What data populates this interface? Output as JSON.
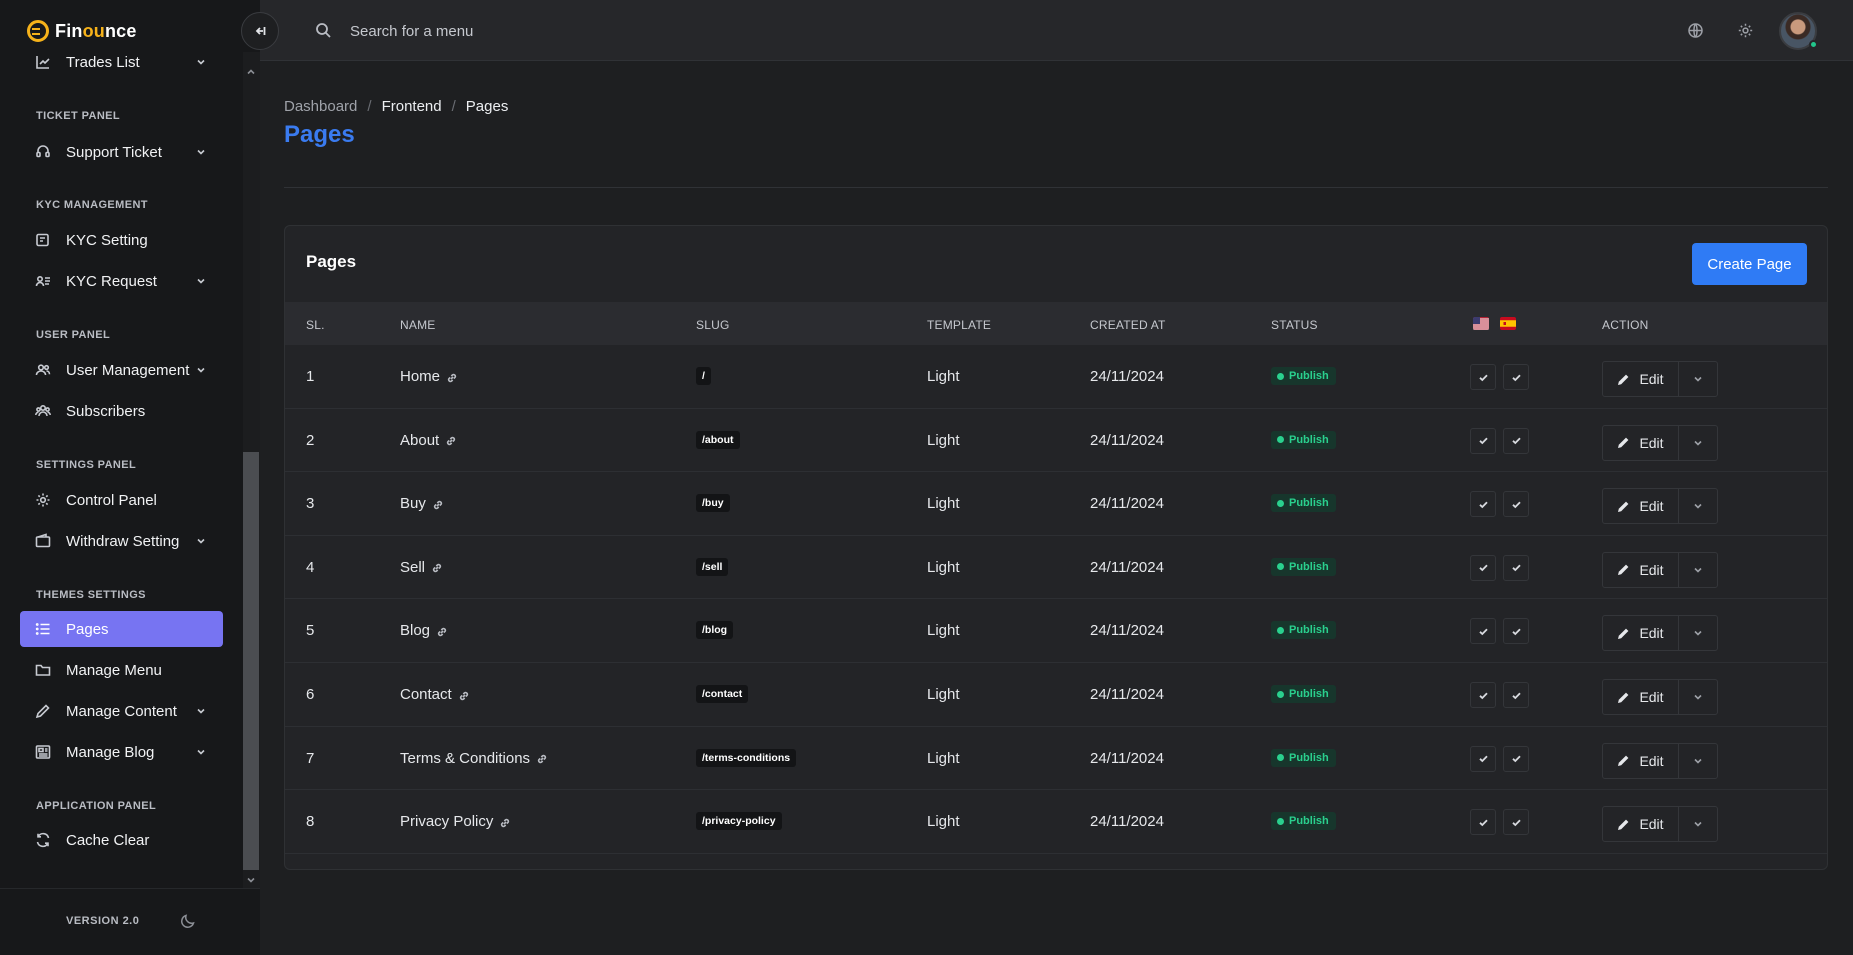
{
  "brand": {
    "name_pre": "Fin",
    "name_hl": "ou",
    "name_post": "nce"
  },
  "sidebar": {
    "sections": [
      {
        "title": ""
      },
      {
        "title": "TICKET PANEL"
      },
      {
        "title": "KYC MANAGEMENT"
      },
      {
        "title": "USER PANEL"
      },
      {
        "title": "SETTINGS PANEL"
      },
      {
        "title": "THEMES SETTINGS"
      },
      {
        "title": "APPLICATION PANEL"
      }
    ],
    "items": [
      {
        "label": "Trades List",
        "icon": "chart-icon",
        "has_chevron": true
      },
      {
        "label": "Support Ticket",
        "icon": "headset-icon",
        "has_chevron": true
      },
      {
        "label": "KYC Setting",
        "icon": "id-card-icon",
        "has_chevron": false
      },
      {
        "label": "KYC Request",
        "icon": "user-list-icon",
        "has_chevron": true
      },
      {
        "label": "User Management",
        "icon": "users-icon",
        "has_chevron": true
      },
      {
        "label": "Subscribers",
        "icon": "group-icon",
        "has_chevron": false
      },
      {
        "label": "Control Panel",
        "icon": "gear-icon",
        "has_chevron": false
      },
      {
        "label": "Withdraw Setting",
        "icon": "wallet-icon",
        "has_chevron": true
      },
      {
        "label": "Pages",
        "icon": "list-icon",
        "has_chevron": false,
        "active": true
      },
      {
        "label": "Manage Menu",
        "icon": "folder-icon",
        "has_chevron": false
      },
      {
        "label": "Manage Content",
        "icon": "pencil-icon",
        "has_chevron": true
      },
      {
        "label": "Manage Blog",
        "icon": "newspaper-icon",
        "has_chevron": true
      },
      {
        "label": "Cache Clear",
        "icon": "refresh-icon",
        "has_chevron": false
      }
    ],
    "version": "VERSION 2.0"
  },
  "header": {
    "search_placeholder": "Search for a menu"
  },
  "breadcrumb": [
    "Dashboard",
    "Frontend",
    "Pages"
  ],
  "page_title": "Pages",
  "card": {
    "title": "Pages",
    "create_label": "Create Page",
    "columns": [
      "SL.",
      "NAME",
      "SLUG",
      "TEMPLATE",
      "CREATED AT",
      "STATUS",
      "ACTION"
    ],
    "language_flags": [
      "us-flag-icon",
      "es-flag-icon"
    ],
    "edit_label": "Edit",
    "rows": [
      {
        "sl": "1",
        "name": "Home",
        "slug": "/",
        "template": "Light",
        "created_at": "24/11/2024",
        "status": "Publish"
      },
      {
        "sl": "2",
        "name": "About",
        "slug": "/about",
        "template": "Light",
        "created_at": "24/11/2024",
        "status": "Publish"
      },
      {
        "sl": "3",
        "name": "Buy",
        "slug": "/buy",
        "template": "Light",
        "created_at": "24/11/2024",
        "status": "Publish"
      },
      {
        "sl": "4",
        "name": "Sell",
        "slug": "/sell",
        "template": "Light",
        "created_at": "24/11/2024",
        "status": "Publish"
      },
      {
        "sl": "5",
        "name": "Blog",
        "slug": "/blog",
        "template": "Light",
        "created_at": "24/11/2024",
        "status": "Publish"
      },
      {
        "sl": "6",
        "name": "Contact",
        "slug": "/contact",
        "template": "Light",
        "created_at": "24/11/2024",
        "status": "Publish"
      },
      {
        "sl": "7",
        "name": "Terms & Conditions",
        "slug": "/terms-conditions",
        "template": "Light",
        "created_at": "24/11/2024",
        "status": "Publish"
      },
      {
        "sl": "8",
        "name": "Privacy Policy",
        "slug": "/privacy-policy",
        "template": "Light",
        "created_at": "24/11/2024",
        "status": "Publish"
      }
    ]
  },
  "colors": {
    "accent": "#2f7bf5",
    "active_nav": "#7774f2",
    "brand": "#f6b21a",
    "publish": "#2ad08e"
  }
}
